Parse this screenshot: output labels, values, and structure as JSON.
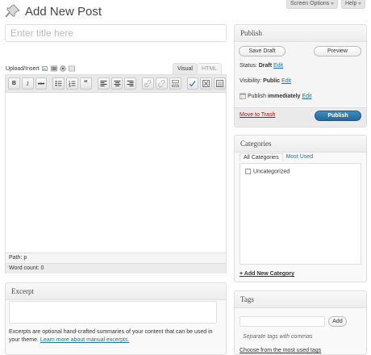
{
  "screen_options": {
    "label": "Screen Options",
    "help_label": "Help"
  },
  "header": {
    "title": "Add New Post"
  },
  "title_field": {
    "placeholder": "Enter title here"
  },
  "upload": {
    "label": "Upload/Insert"
  },
  "editor": {
    "tab_visual": "Visual",
    "tab_html": "HTML",
    "toolbar": {
      "bold": "B",
      "italic": "I",
      "strike": "ABC",
      "quote": "“"
    },
    "path_label": "Path:",
    "path_value": "p",
    "word_count": "Word count: 0"
  },
  "publish": {
    "title": "Publish",
    "save_draft": "Save Draft",
    "preview": "Preview",
    "status_label": "Status:",
    "status_value": "Draft",
    "visibility_label": "Visibility:",
    "visibility_value": "Public",
    "publish_label": "Publish",
    "publish_value": "immediately",
    "edit": "Edit",
    "trash": "Move to Trash",
    "publish_button": "Publish"
  },
  "categories": {
    "title": "Categories",
    "tab_all": "All Categories",
    "tab_used": "Most Used",
    "items": [
      "Uncategorized"
    ],
    "add_new": "+ Add New Category"
  },
  "tags": {
    "title": "Tags",
    "add_button": "Add",
    "help": "Separate tags with commas",
    "choose": "Choose from the most used tags"
  },
  "excerpt": {
    "title": "Excerpt",
    "help_text": "Excerpts are optional hand-crafted summaries of your content that can be used in your theme.",
    "help_link": "Learn more about manual excerpts."
  },
  "colors": {
    "link": "#21759b",
    "primary": "#22679a",
    "trash": "#bc0b0b"
  }
}
